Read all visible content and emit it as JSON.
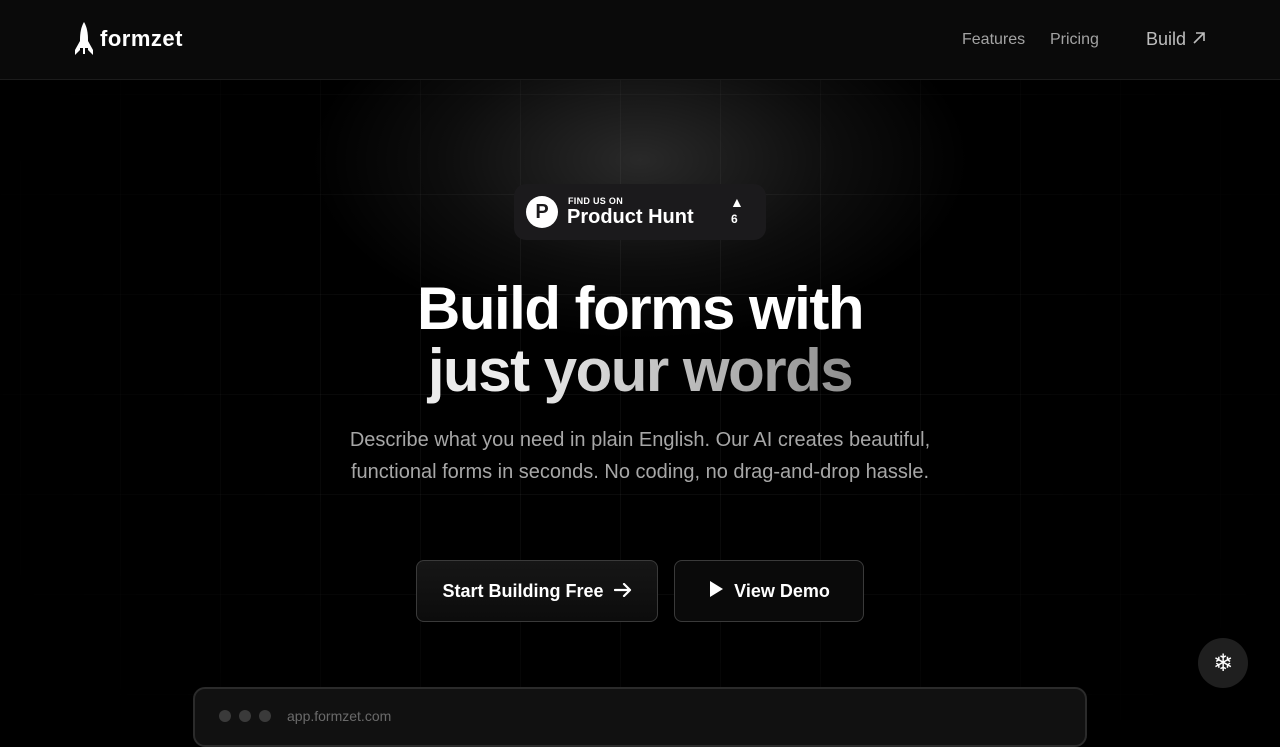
{
  "brand": {
    "name": "formzet"
  },
  "nav": {
    "links": [
      "Features",
      "Pricing"
    ],
    "build_label": "Build"
  },
  "product_hunt": {
    "small_text": "FIND US ON",
    "name": "Product Hunt",
    "upvotes": "6"
  },
  "hero": {
    "title_line1": "Build forms with",
    "title_line2_a": "just",
    "title_line2_b": "your words",
    "subtitle": "Describe what you need in plain English. Our AI creates beautiful, functional forms in seconds. No coding, no drag-and-drop hassle."
  },
  "buttons": {
    "start_label": "Start Building Free",
    "demo_label": "View Demo"
  },
  "preview": {
    "url": "app.formzet.com"
  },
  "icons": {
    "logo": "rocket-icon",
    "build": "arrow-up-right-icon",
    "start": "arrow-right-icon",
    "demo": "play-icon",
    "floating": "snowflake-icon"
  }
}
